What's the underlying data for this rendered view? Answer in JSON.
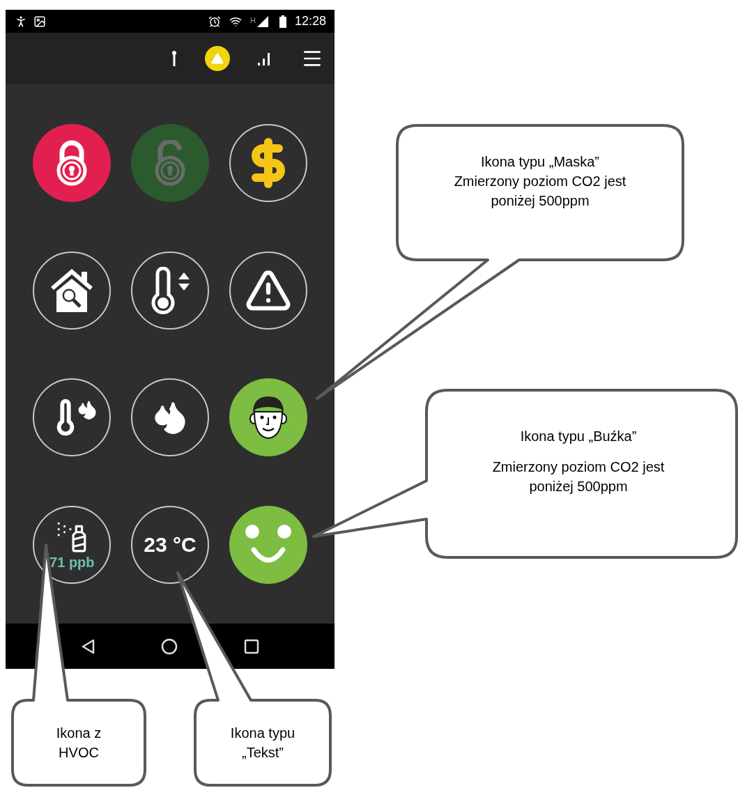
{
  "status_bar": {
    "network_type": "H",
    "time": "12:28"
  },
  "app_bar": {
    "alert_active": true
  },
  "tiles": [
    {
      "kind": "lock-closed",
      "color": "#e2204f"
    },
    {
      "kind": "lock-open",
      "color": "#2b5a2e"
    },
    {
      "kind": "dollar"
    },
    {
      "kind": "house-search"
    },
    {
      "kind": "thermostat"
    },
    {
      "kind": "warning"
    },
    {
      "kind": "temp-humidity"
    },
    {
      "kind": "humidity"
    },
    {
      "kind": "mask-face",
      "color": "#7cbd42"
    },
    {
      "kind": "hvoc",
      "reading": "71 ppb"
    },
    {
      "kind": "text",
      "reading": "23 °C"
    },
    {
      "kind": "smiley",
      "color": "#7cbd42"
    }
  ],
  "callouts": [
    {
      "paragraphs": [
        "Ikona typu „Maska”",
        "Zmierzony poziom CO2 jest poniżej 500ppm"
      ]
    },
    {
      "paragraphs": [
        "Ikona typu „Buźka”",
        "Zmierzony poziom CO2 jest poniżej 500ppm"
      ]
    },
    {
      "paragraphs": [
        "Ikona z HVOC"
      ]
    },
    {
      "paragraphs": [
        "Ikona typu „Tekst”"
      ]
    }
  ]
}
